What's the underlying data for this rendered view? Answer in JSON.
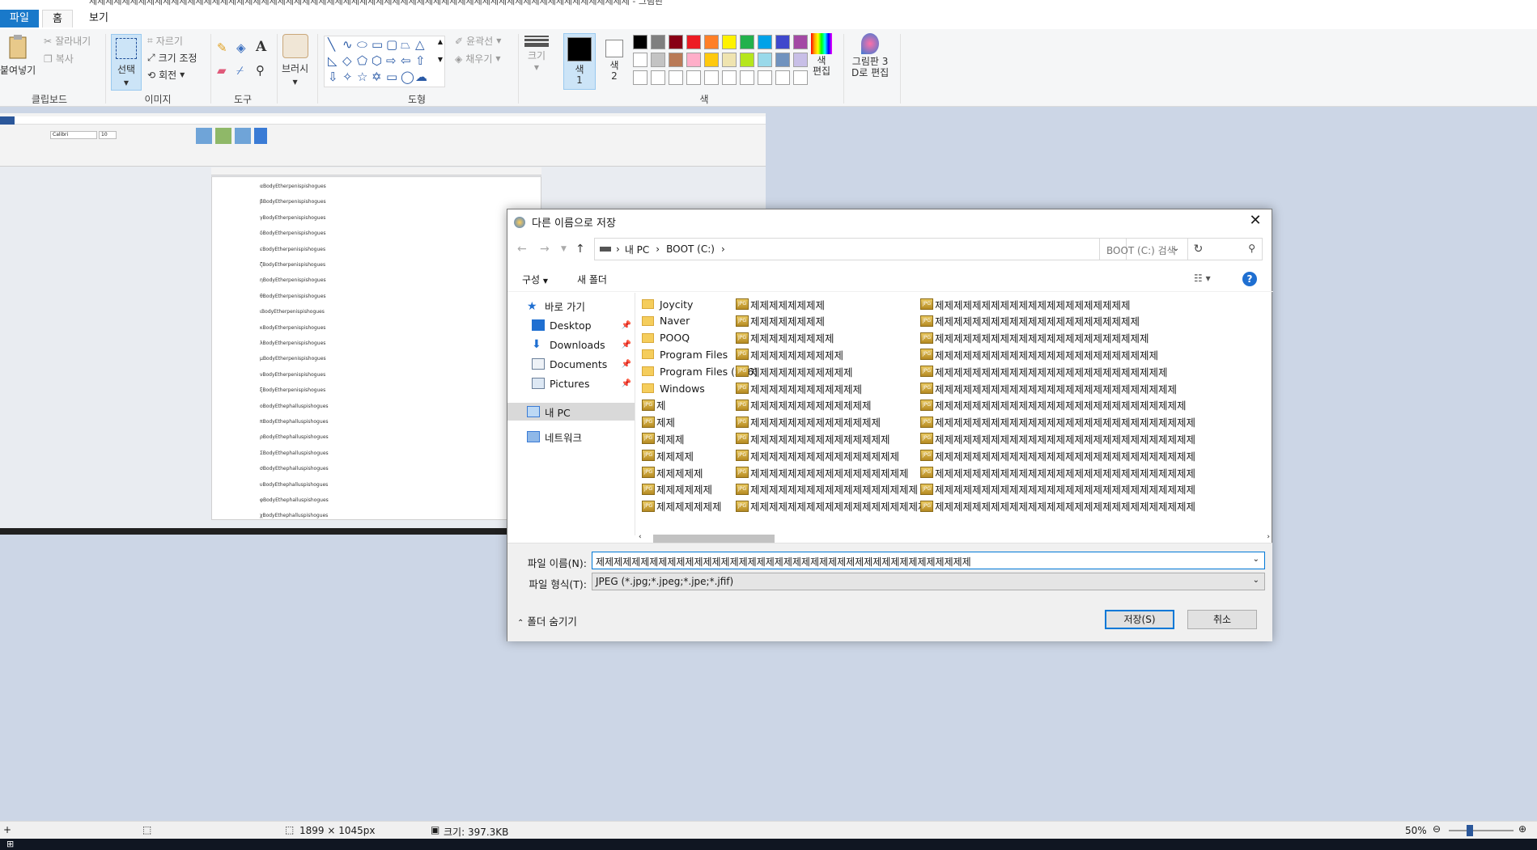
{
  "window": {
    "title": "제제제제제제제제제제제제제제제제제제제제제제제제제제제제제제제제제제제제제제제제제제제제제제제제제제제제제제제제제제제제제제제제제제 - 그림판"
  },
  "menu_tabs": {
    "file": "파일",
    "home": "홈",
    "view": "보기"
  },
  "ribbon": {
    "clipboard": {
      "paste": "붙여넣기",
      "cut": "잘라내기",
      "copy": "복사",
      "label": "클립보드"
    },
    "image": {
      "select": "선택",
      "crop": "자르기",
      "resize": "크기 조정",
      "rotate": "회전",
      "label": "이미지"
    },
    "tools": {
      "label": "도구"
    },
    "brushes": {
      "label": "브러시"
    },
    "shapes": {
      "outline": "윤곽선",
      "fill": "채우기",
      "label": "도형"
    },
    "size": {
      "label": "크기"
    },
    "colors": {
      "color1": "색\n1",
      "color2": "색\n2",
      "edit": "색\n편집",
      "paint3d": "그림판 3\nD로 편집",
      "label": "색",
      "palette_row1": [
        "#000000",
        "#7f7f7f",
        "#880015",
        "#ed1c24",
        "#ff7f27",
        "#fff200",
        "#22b14c",
        "#00a2e8",
        "#3f48cc",
        "#a349a4"
      ],
      "palette_row2": [
        "#ffffff",
        "#c3c3c3",
        "#b97a57",
        "#ffaec9",
        "#ffc90e",
        "#efe4b0",
        "#b5e61d",
        "#99d9ea",
        "#7092be",
        "#c8bfe7"
      ]
    }
  },
  "embedded_doc": {
    "lines": [
      "αBodyEtherpenispishogues",
      "βBodyEtherpenispishogues",
      "γBodyEtherpenispishogues",
      "δBodyEtherpenispishogues",
      "εBodyEtherpenispishogues",
      "ζBodyEtherpenispishogues",
      "ηBodyEtherpenispishogues",
      "θBodyEtherpenispishogues",
      "ιBodyEtherpenispishogues",
      "κBodyEtherpenispishogues",
      "λBodyEtherpenispishogues",
      "μBodyEtherpenispishogues",
      "νBodyEtherpenispishogues",
      "ξBodyEtherpenispishogues",
      "οBodyEthephalluspishogues",
      "πBodyEthephalluspishogues",
      "ρBodyEthephalluspishogues",
      "ΣBodyEthephalluspishogues",
      "σBodyEthephalluspishogues",
      "υBodyEthephalluspishogues",
      "φBodyEthephalluspishogues",
      "χBodyEthephalluspishogues"
    ],
    "font": "Calibri",
    "size": "10"
  },
  "dialog": {
    "title": "다른 이름으로 저장",
    "breadcrumb": [
      "내 PC",
      "BOOT (C:)"
    ],
    "search_placeholder": "BOOT (C:) 검색",
    "organize": "구성",
    "new_folder": "새 폴더",
    "nav": [
      {
        "label": "바로 가기"
      },
      {
        "label": "Desktop"
      },
      {
        "label": "Downloads"
      },
      {
        "label": "Documents"
      },
      {
        "label": "Pictures"
      },
      {
        "label": "내 PC"
      },
      {
        "label": "네트워크"
      }
    ],
    "col1": [
      "Joycity",
      "Naver",
      "POOQ",
      "Program Files",
      "Program Files (x86)",
      "Windows",
      "제",
      "제제",
      "제제제",
      "제제제제",
      "제제제제제",
      "제제제제제제",
      "제제제제제제제"
    ],
    "col2": [
      "제제제제제제제제",
      "제제제제제제제제",
      "제제제제제제제제제",
      "제제제제제제제제제제",
      "제제제제제제제제제제제",
      "제제제제제제제제제제제제",
      "제제제제제제제제제제제제제",
      "제제제제제제제제제제제제제제",
      "제제제제제제제제제제제제제제제",
      "제제제제제제제제제제제제제제제제",
      "제제제제제제제제제제제제제제제제제",
      "제제제제제제제제제제제제제제제제제제",
      "제제제제제제제제제제제제제제제제제제제"
    ],
    "col3": [
      "제제제제제제제제제제제제제제제제제제제제제",
      "제제제제제제제제제제제제제제제제제제제제제제",
      "제제제제제제제제제제제제제제제제제제제제제제제",
      "제제제제제제제제제제제제제제제제제제제제제제제제",
      "제제제제제제제제제제제제제제제제제제제제제제제제제",
      "제제제제제제제제제제제제제제제제제제제제제제제제제제",
      "제제제제제제제제제제제제제제제제제제제제제제제제제제제",
      "제제제제제제제제제제제제제제제제제제제제제제제제제제제제",
      "제제제제제제제제제제제제제제제제제제제제제제제제제제제제",
      "제제제제제제제제제제제제제제제제제제제제제제제제제제제제",
      "제제제제제제제제제제제제제제제제제제제제제제제제제제제제",
      "제제제제제제제제제제제제제제제제제제제제제제제제제제제제",
      "제제제제제제제제제제제제제제제제제제제제제제제제제제제제"
    ],
    "filename_label": "파일 이름(N):",
    "filename_value": "제제제제제제제제제제제제제제제제제제제제제제제제제제제제제제제제제제제제제제제제제제",
    "filetype_label": "파일 형식(T):",
    "filetype_value": "JPEG (*.jpg;*.jpeg;*.jpe;*.jfif)",
    "hide_folders": "폴더 숨기기",
    "save": "저장(S)",
    "cancel": "취소"
  },
  "status": {
    "dimensions": "1899 × 1045px",
    "size": "크기: 397.3KB",
    "zoom": "50%"
  }
}
